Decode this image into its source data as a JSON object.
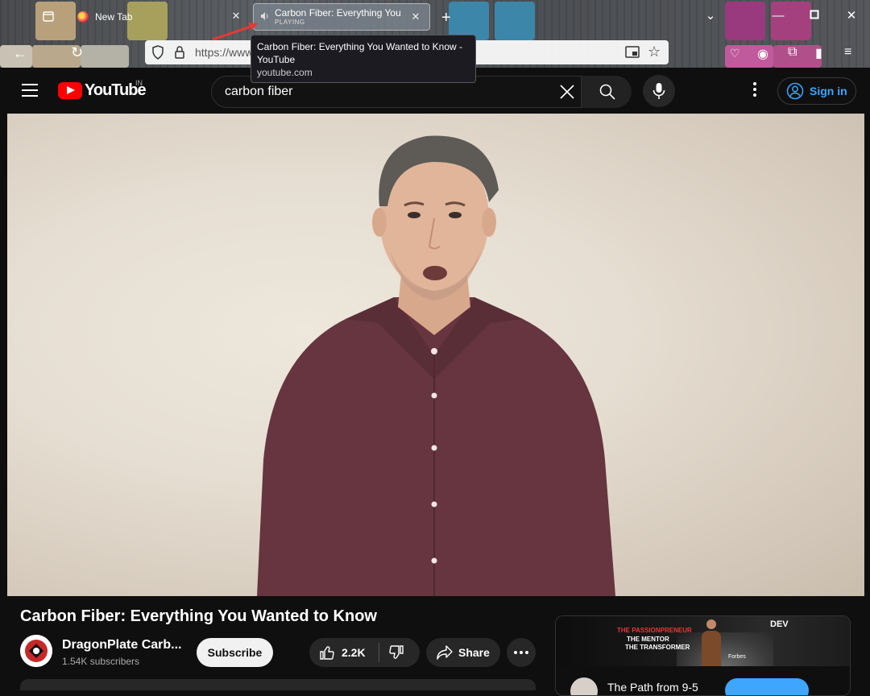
{
  "browser": {
    "tabs": [
      {
        "title": "New Tab"
      },
      {
        "title": "Carbon Fiber: Everything You",
        "status": "PLAYING"
      }
    ],
    "url_display": "https://www",
    "tooltip": {
      "title": "Carbon Fiber: Everything You Wanted to Know - YouTube",
      "url": "youtube.com"
    }
  },
  "youtube": {
    "logo_text": "YouTube",
    "country_code": "IN",
    "search": {
      "value": "carbon fiber"
    },
    "sign_in_label": "Sign in"
  },
  "video": {
    "title": "Carbon Fiber: Everything You Wanted to Know",
    "channel": {
      "name": "DragonPlate Carb...",
      "subscribers": "1.54K subscribers"
    },
    "subscribe_label": "Subscribe",
    "like_count": "2.2K",
    "share_label": "Share"
  },
  "ad": {
    "line1": "THE PASSIONPRENEUR",
    "line2": "THE MENTOR",
    "line3": "THE TRANSFORMER",
    "brand": "DEV",
    "forbes": "Forbes",
    "title": "The Path from 9-5"
  },
  "colors": {
    "yt_red": "#ff0000",
    "link_blue": "#3ea6ff",
    "page_bg": "#0f0f0f",
    "annotation_arrow": "#e53935"
  }
}
